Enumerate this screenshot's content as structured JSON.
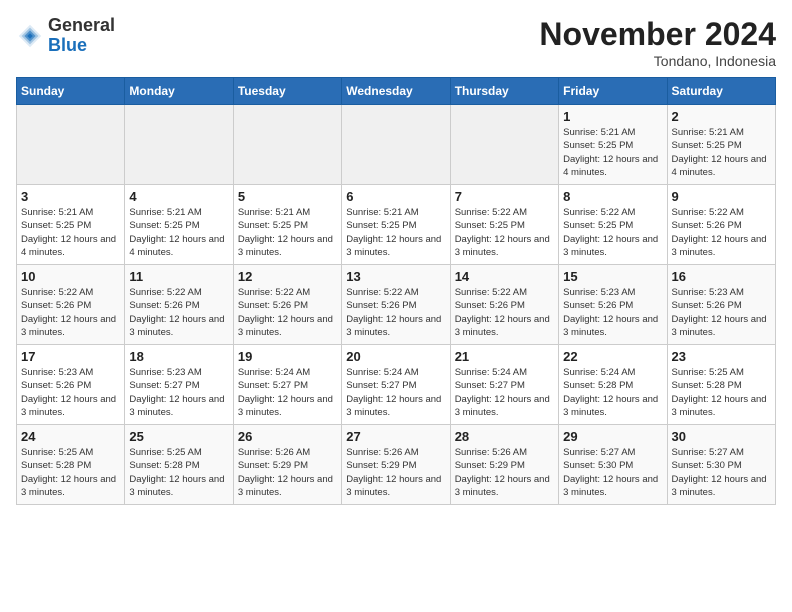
{
  "logo": {
    "text_general": "General",
    "text_blue": "Blue"
  },
  "header": {
    "month": "November 2024",
    "location": "Tondano, Indonesia"
  },
  "weekdays": [
    "Sunday",
    "Monday",
    "Tuesday",
    "Wednesday",
    "Thursday",
    "Friday",
    "Saturday"
  ],
  "weeks": [
    [
      {
        "day": "",
        "info": ""
      },
      {
        "day": "",
        "info": ""
      },
      {
        "day": "",
        "info": ""
      },
      {
        "day": "",
        "info": ""
      },
      {
        "day": "",
        "info": ""
      },
      {
        "day": "1",
        "info": "Sunrise: 5:21 AM\nSunset: 5:25 PM\nDaylight: 12 hours and 4 minutes."
      },
      {
        "day": "2",
        "info": "Sunrise: 5:21 AM\nSunset: 5:25 PM\nDaylight: 12 hours and 4 minutes."
      }
    ],
    [
      {
        "day": "3",
        "info": "Sunrise: 5:21 AM\nSunset: 5:25 PM\nDaylight: 12 hours and 4 minutes."
      },
      {
        "day": "4",
        "info": "Sunrise: 5:21 AM\nSunset: 5:25 PM\nDaylight: 12 hours and 4 minutes."
      },
      {
        "day": "5",
        "info": "Sunrise: 5:21 AM\nSunset: 5:25 PM\nDaylight: 12 hours and 3 minutes."
      },
      {
        "day": "6",
        "info": "Sunrise: 5:21 AM\nSunset: 5:25 PM\nDaylight: 12 hours and 3 minutes."
      },
      {
        "day": "7",
        "info": "Sunrise: 5:22 AM\nSunset: 5:25 PM\nDaylight: 12 hours and 3 minutes."
      },
      {
        "day": "8",
        "info": "Sunrise: 5:22 AM\nSunset: 5:25 PM\nDaylight: 12 hours and 3 minutes."
      },
      {
        "day": "9",
        "info": "Sunrise: 5:22 AM\nSunset: 5:26 PM\nDaylight: 12 hours and 3 minutes."
      }
    ],
    [
      {
        "day": "10",
        "info": "Sunrise: 5:22 AM\nSunset: 5:26 PM\nDaylight: 12 hours and 3 minutes."
      },
      {
        "day": "11",
        "info": "Sunrise: 5:22 AM\nSunset: 5:26 PM\nDaylight: 12 hours and 3 minutes."
      },
      {
        "day": "12",
        "info": "Sunrise: 5:22 AM\nSunset: 5:26 PM\nDaylight: 12 hours and 3 minutes."
      },
      {
        "day": "13",
        "info": "Sunrise: 5:22 AM\nSunset: 5:26 PM\nDaylight: 12 hours and 3 minutes."
      },
      {
        "day": "14",
        "info": "Sunrise: 5:22 AM\nSunset: 5:26 PM\nDaylight: 12 hours and 3 minutes."
      },
      {
        "day": "15",
        "info": "Sunrise: 5:23 AM\nSunset: 5:26 PM\nDaylight: 12 hours and 3 minutes."
      },
      {
        "day": "16",
        "info": "Sunrise: 5:23 AM\nSunset: 5:26 PM\nDaylight: 12 hours and 3 minutes."
      }
    ],
    [
      {
        "day": "17",
        "info": "Sunrise: 5:23 AM\nSunset: 5:26 PM\nDaylight: 12 hours and 3 minutes."
      },
      {
        "day": "18",
        "info": "Sunrise: 5:23 AM\nSunset: 5:27 PM\nDaylight: 12 hours and 3 minutes."
      },
      {
        "day": "19",
        "info": "Sunrise: 5:24 AM\nSunset: 5:27 PM\nDaylight: 12 hours and 3 minutes."
      },
      {
        "day": "20",
        "info": "Sunrise: 5:24 AM\nSunset: 5:27 PM\nDaylight: 12 hours and 3 minutes."
      },
      {
        "day": "21",
        "info": "Sunrise: 5:24 AM\nSunset: 5:27 PM\nDaylight: 12 hours and 3 minutes."
      },
      {
        "day": "22",
        "info": "Sunrise: 5:24 AM\nSunset: 5:28 PM\nDaylight: 12 hours and 3 minutes."
      },
      {
        "day": "23",
        "info": "Sunrise: 5:25 AM\nSunset: 5:28 PM\nDaylight: 12 hours and 3 minutes."
      }
    ],
    [
      {
        "day": "24",
        "info": "Sunrise: 5:25 AM\nSunset: 5:28 PM\nDaylight: 12 hours and 3 minutes."
      },
      {
        "day": "25",
        "info": "Sunrise: 5:25 AM\nSunset: 5:28 PM\nDaylight: 12 hours and 3 minutes."
      },
      {
        "day": "26",
        "info": "Sunrise: 5:26 AM\nSunset: 5:29 PM\nDaylight: 12 hours and 3 minutes."
      },
      {
        "day": "27",
        "info": "Sunrise: 5:26 AM\nSunset: 5:29 PM\nDaylight: 12 hours and 3 minutes."
      },
      {
        "day": "28",
        "info": "Sunrise: 5:26 AM\nSunset: 5:29 PM\nDaylight: 12 hours and 3 minutes."
      },
      {
        "day": "29",
        "info": "Sunrise: 5:27 AM\nSunset: 5:30 PM\nDaylight: 12 hours and 3 minutes."
      },
      {
        "day": "30",
        "info": "Sunrise: 5:27 AM\nSunset: 5:30 PM\nDaylight: 12 hours and 3 minutes."
      }
    ]
  ]
}
